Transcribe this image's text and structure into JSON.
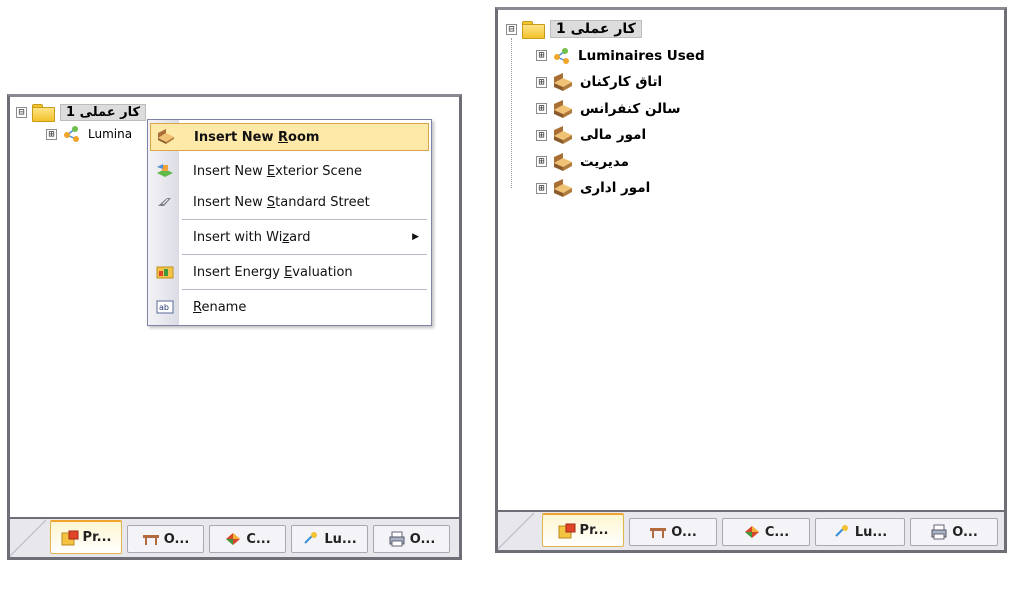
{
  "left_panel": {
    "tree": {
      "root": {
        "label": "کار عملی 1",
        "expander": "⊟"
      },
      "child": {
        "label": "Lumina",
        "expander": "⊞"
      }
    },
    "context_menu": {
      "items": [
        {
          "pre": "Insert New ",
          "key": "R",
          "post": "oom",
          "icon": "room-icon"
        },
        {
          "pre": "Insert New ",
          "key": "E",
          "post": "xterior Scene",
          "icon": "exterior-scene-icon"
        },
        {
          "pre": "Insert New ",
          "key": "S",
          "post": "tandard Street",
          "icon": "street-icon"
        },
        {
          "pre": "Insert with Wi",
          "key": "z",
          "post": "ard",
          "arrow": "▶"
        },
        {
          "pre": "Insert Energy ",
          "key": "E",
          "post": "valuation",
          "icon": "energy-evaluation-icon"
        },
        {
          "pre": "",
          "key": "R",
          "post": "ename",
          "icon": "rename-icon"
        }
      ]
    },
    "tabs": [
      "Pr...",
      "O...",
      "C...",
      "Lu...",
      "O..."
    ]
  },
  "right_panel": {
    "tree": {
      "root": {
        "label": "کار عملی 1",
        "expander": "⊟"
      },
      "children": [
        {
          "label": "Luminaires Used",
          "expander": "⊞",
          "icon": "luminaires-icon"
        },
        {
          "label": "اتاق کارکنان",
          "expander": "⊞",
          "icon": "room-icon"
        },
        {
          "label": "سالن کنفرانس",
          "expander": "⊞",
          "icon": "room-icon"
        },
        {
          "label": "امور مالی",
          "expander": "⊞",
          "icon": "room-icon"
        },
        {
          "label": "مدیریت",
          "expander": "⊞",
          "icon": "room-icon"
        },
        {
          "label": "امور اداری",
          "expander": "⊞",
          "icon": "room-icon"
        }
      ]
    },
    "tabs": [
      "Pr...",
      "O...",
      "C...",
      "Lu...",
      "O..."
    ]
  },
  "colors": {
    "highlight": "#ffe9a8",
    "active_tab": "#f2a431",
    "panel_border": "#6e6e76"
  }
}
